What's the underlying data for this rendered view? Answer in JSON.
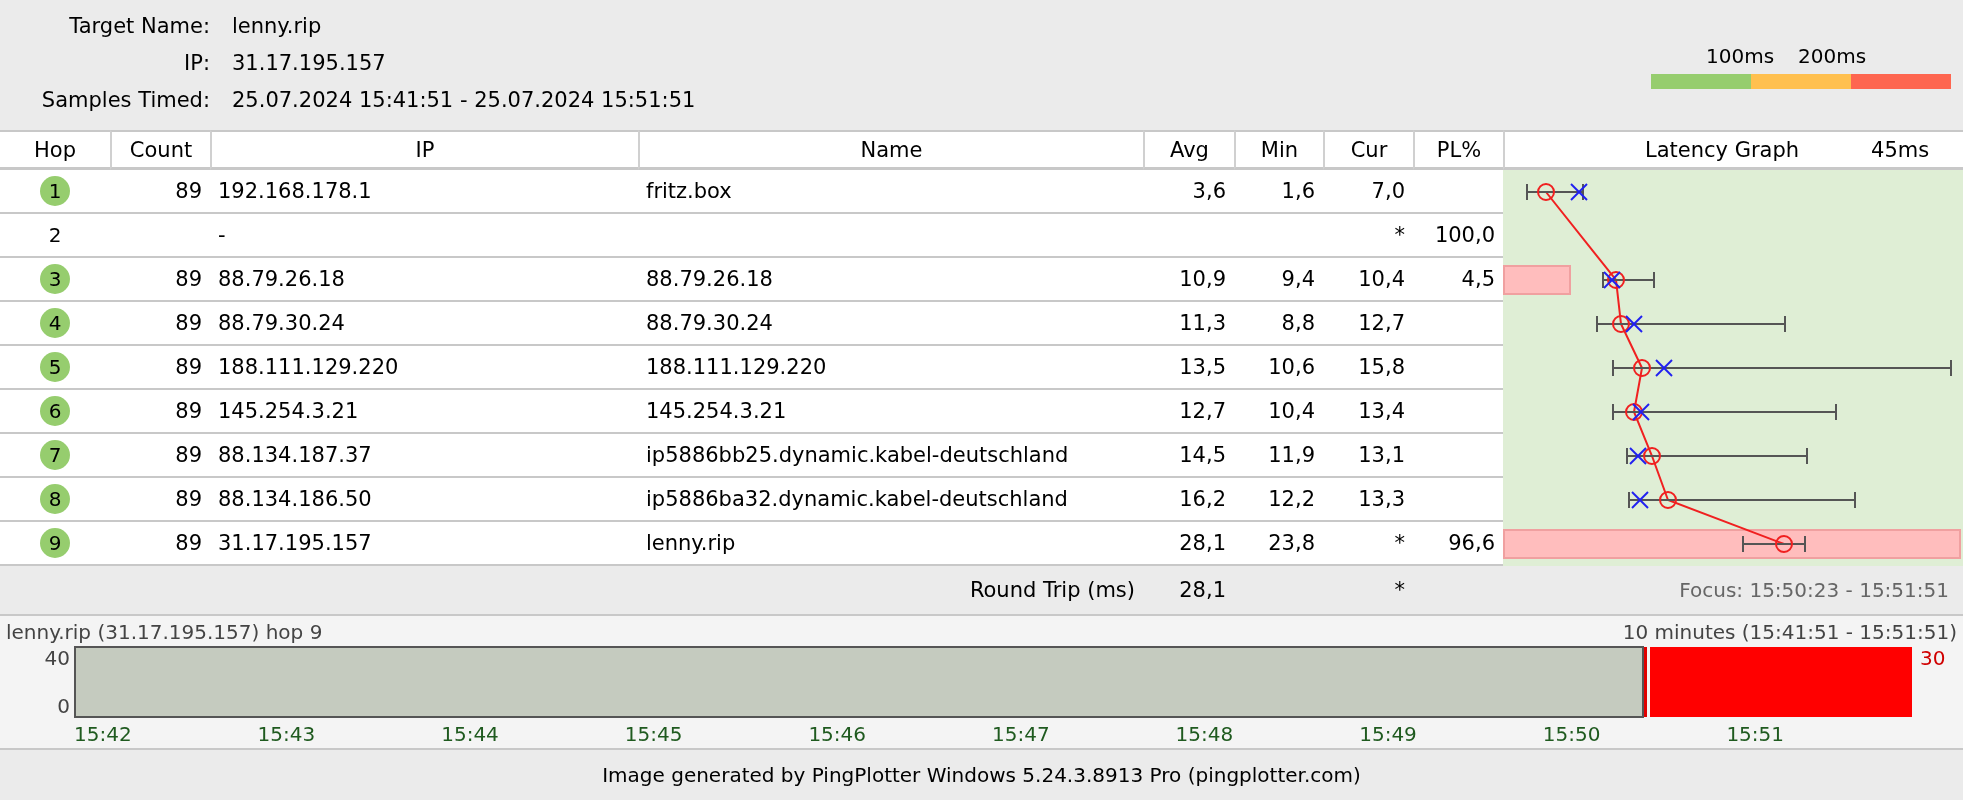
{
  "target": {
    "fields": [
      {
        "label": "Target Name:",
        "value": "lenny.rip"
      },
      {
        "label": "IP:",
        "value": "31.17.195.157"
      },
      {
        "label": "Samples Timed:",
        "value": "25.07.2024 15:41:51 - 25.07.2024 15:51:51"
      }
    ]
  },
  "legend": {
    "labels": [
      "100ms",
      "200ms"
    ]
  },
  "table": {
    "columns": [
      "Hop",
      "Count",
      "IP",
      "Name",
      "Avg",
      "Min",
      "Cur",
      "PL%",
      "Latency Graph"
    ],
    "graph_scale": "45ms",
    "rows": [
      {
        "hop": "1",
        "responding": true,
        "count": "89",
        "ip": "192.168.178.1",
        "name": "fritz.box",
        "avg": "3,6",
        "min": "1,6",
        "cur": "7,0"
      },
      {
        "hop": "2",
        "responding": false,
        "ip": "-",
        "cur": "*",
        "pl": "100,0"
      },
      {
        "hop": "3",
        "responding": true,
        "count": "89",
        "ip": "88.79.26.18",
        "name": "88.79.26.18",
        "avg": "10,9",
        "min": "9,4",
        "cur": "10,4",
        "pl": "4,5"
      },
      {
        "hop": "4",
        "responding": true,
        "count": "89",
        "ip": "88.79.30.24",
        "name": "88.79.30.24",
        "avg": "11,3",
        "min": "8,8",
        "cur": "12,7"
      },
      {
        "hop": "5",
        "responding": true,
        "count": "89",
        "ip": "188.111.129.220",
        "name": "188.111.129.220",
        "avg": "13,5",
        "min": "10,6",
        "cur": "15,8"
      },
      {
        "hop": "6",
        "responding": true,
        "count": "89",
        "ip": "145.254.3.21",
        "name": "145.254.3.21",
        "avg": "12,7",
        "min": "10,4",
        "cur": "13,4"
      },
      {
        "hop": "7",
        "responding": true,
        "count": "89",
        "ip": "88.134.187.37",
        "name": "ip5886bb25.dynamic.kabel-deutschland",
        "avg": "14,5",
        "min": "11,9",
        "cur": "13,1"
      },
      {
        "hop": "8",
        "responding": true,
        "count": "89",
        "ip": "88.134.186.50",
        "name": "ip5886ba32.dynamic.kabel-deutschland",
        "avg": "16,2",
        "min": "12,2",
        "cur": "13,3"
      },
      {
        "hop": "9",
        "responding": true,
        "count": "89",
        "ip": "31.17.195.157",
        "name": "lenny.rip",
        "avg": "28,1",
        "min": "23,8",
        "cur": "*",
        "pl": "96,6"
      }
    ],
    "round_trip": {
      "label": "Round Trip (ms)",
      "avg": "28,1",
      "cur": "*"
    },
    "focus": "Focus: 15:50:23 - 15:51:51"
  },
  "timeline": {
    "title": "lenny.rip (31.17.195.157) hop 9",
    "range": "10 minutes (15:41:51 - 15:51:51)",
    "y_labels": [
      "40",
      "0"
    ],
    "current_value": "30",
    "time_labels": [
      "15:42",
      "15:43",
      "15:44",
      "15:45",
      "15:46",
      "15:47",
      "15:48",
      "15:49",
      "15:50",
      "15:51"
    ]
  },
  "footer": "Image generated by PingPlotter Windows 5.24.3.8913 Pro (pingplotter.com)"
}
